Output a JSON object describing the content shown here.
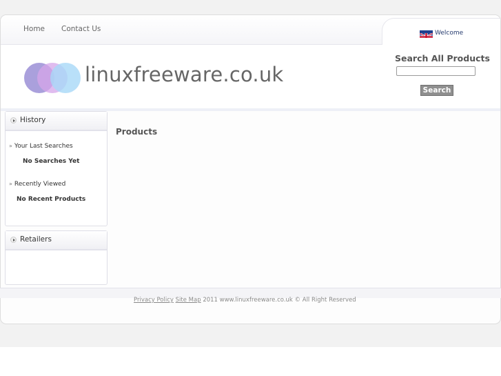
{
  "nav": {
    "home": "Home",
    "contact": "Contact Us",
    "welcome": "Welcome",
    "flag_icon": "uk-flag-icon"
  },
  "header": {
    "logo_text": "linuxfreeware.co.uk",
    "logo_colors": [
      "#9b8fd6",
      "#d6a6ea",
      "#a8d8f8"
    ],
    "search_label": "Search All Products",
    "search_value": "",
    "search_button": "Search"
  },
  "history": {
    "title": "History",
    "last_searches_label": "Your Last Searches",
    "no_searches": "No Searches Yet",
    "recently_viewed_label": "Recently Viewed",
    "no_recent": "No Recent Products"
  },
  "retailers": {
    "title": "Retailers"
  },
  "content": {
    "title": "Products"
  },
  "footer": {
    "privacy": "Privacy Policy",
    "sitemap": "Site Map",
    "copyright": "2011 www.linuxfreeware.co.uk © All Right Reserved"
  }
}
